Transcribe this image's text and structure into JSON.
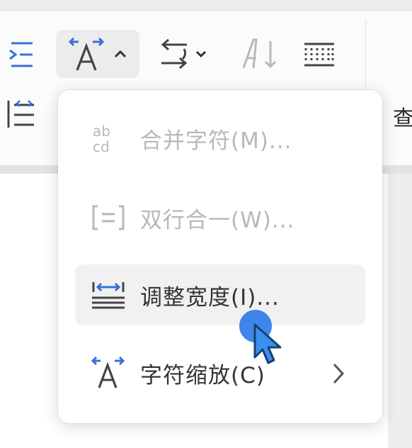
{
  "ribbon": {
    "buttons": [
      {
        "icon": "indent-icon"
      },
      {
        "icon": "character-layout-icon",
        "active": true
      },
      {
        "icon": "text-direction-icon"
      },
      {
        "icon": "sort-icon"
      },
      {
        "icon": "line-spacing-icon"
      },
      {
        "icon": "distribute-spacing-icon"
      }
    ],
    "cutoff_text": "查"
  },
  "menu": {
    "items": [
      {
        "label": "合并字符(M)...",
        "icon": "combine-characters-icon",
        "enabled": false
      },
      {
        "label": "双行合一(W)...",
        "icon": "two-lines-in-one-icon",
        "enabled": false
      },
      {
        "label": "调整宽度(I)...",
        "icon": "adjust-width-icon",
        "enabled": true,
        "hovered": true
      },
      {
        "label": "字符缩放(C)",
        "icon": "character-scale-icon",
        "enabled": true,
        "submenu": true
      }
    ]
  },
  "colors": {
    "accent_blue": "#2f7bea",
    "icon_blue": "#3a6fd8",
    "icon_gray": "#444444",
    "disabled_gray": "#b8b8b8",
    "hover_bg": "#f1f1f1"
  }
}
